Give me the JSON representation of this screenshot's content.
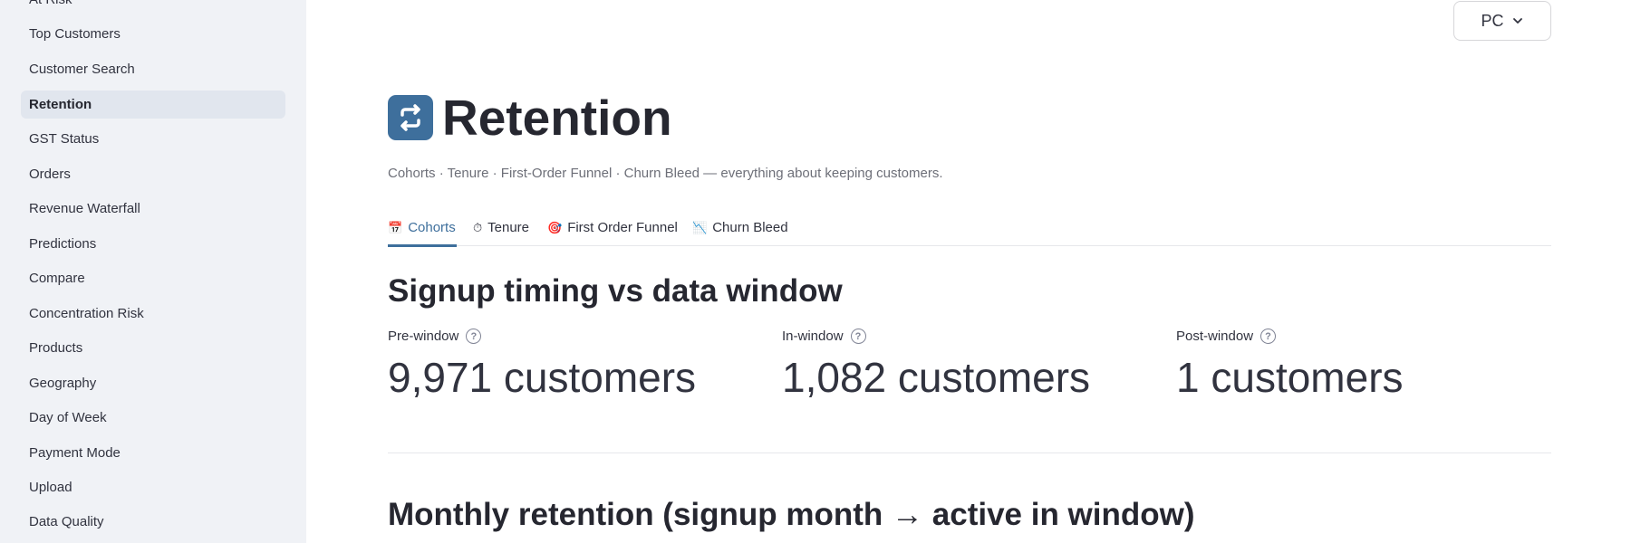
{
  "sidebar": {
    "items": [
      {
        "label": "At Risk",
        "active": false
      },
      {
        "label": "Top Customers",
        "active": false
      },
      {
        "label": "Customer Search",
        "active": false
      },
      {
        "label": "Retention",
        "active": true
      },
      {
        "label": "GST Status",
        "active": false
      },
      {
        "label": "Orders",
        "active": false
      },
      {
        "label": "Revenue Waterfall",
        "active": false
      },
      {
        "label": "Predictions",
        "active": false
      },
      {
        "label": "Compare",
        "active": false
      },
      {
        "label": "Concentration Risk",
        "active": false
      },
      {
        "label": "Products",
        "active": false
      },
      {
        "label": "Geography",
        "active": false
      },
      {
        "label": "Day of Week",
        "active": false
      },
      {
        "label": "Payment Mode",
        "active": false
      },
      {
        "label": "Upload",
        "active": false
      },
      {
        "label": "Data Quality",
        "active": false
      }
    ]
  },
  "header": {
    "selector_value": "PC",
    "title": "Retention",
    "title_icon": "repeat-icon",
    "caption": "Cohorts · Tenure · First-Order Funnel · Churn Bleed — everything about keeping customers."
  },
  "tabs": [
    {
      "icon": "📅",
      "icon_name": "calendar-icon",
      "label": "Cohorts",
      "active": true
    },
    {
      "icon": "⏱",
      "icon_name": "stopwatch-icon",
      "label": "Tenure",
      "active": false
    },
    {
      "icon": "🎯",
      "icon_name": "target-icon",
      "label": "First Order Funnel",
      "active": false
    },
    {
      "icon": "📉",
      "icon_name": "chart-down-icon",
      "label": "Churn Bleed",
      "active": false
    }
  ],
  "section1": {
    "title": "Signup timing vs data window",
    "metrics": [
      {
        "label": "Pre-window",
        "value": "9,971 customers"
      },
      {
        "label": "In-window",
        "value": "1,082 customers"
      },
      {
        "label": "Post-window",
        "value": "1 customers"
      }
    ]
  },
  "section2": {
    "title": "Monthly retention (signup month → active in window)"
  },
  "colors": {
    "accent": "#3e6f9c",
    "sidebar_bg": "#f0f2f6",
    "active_item_bg": "#e1e6ee"
  }
}
